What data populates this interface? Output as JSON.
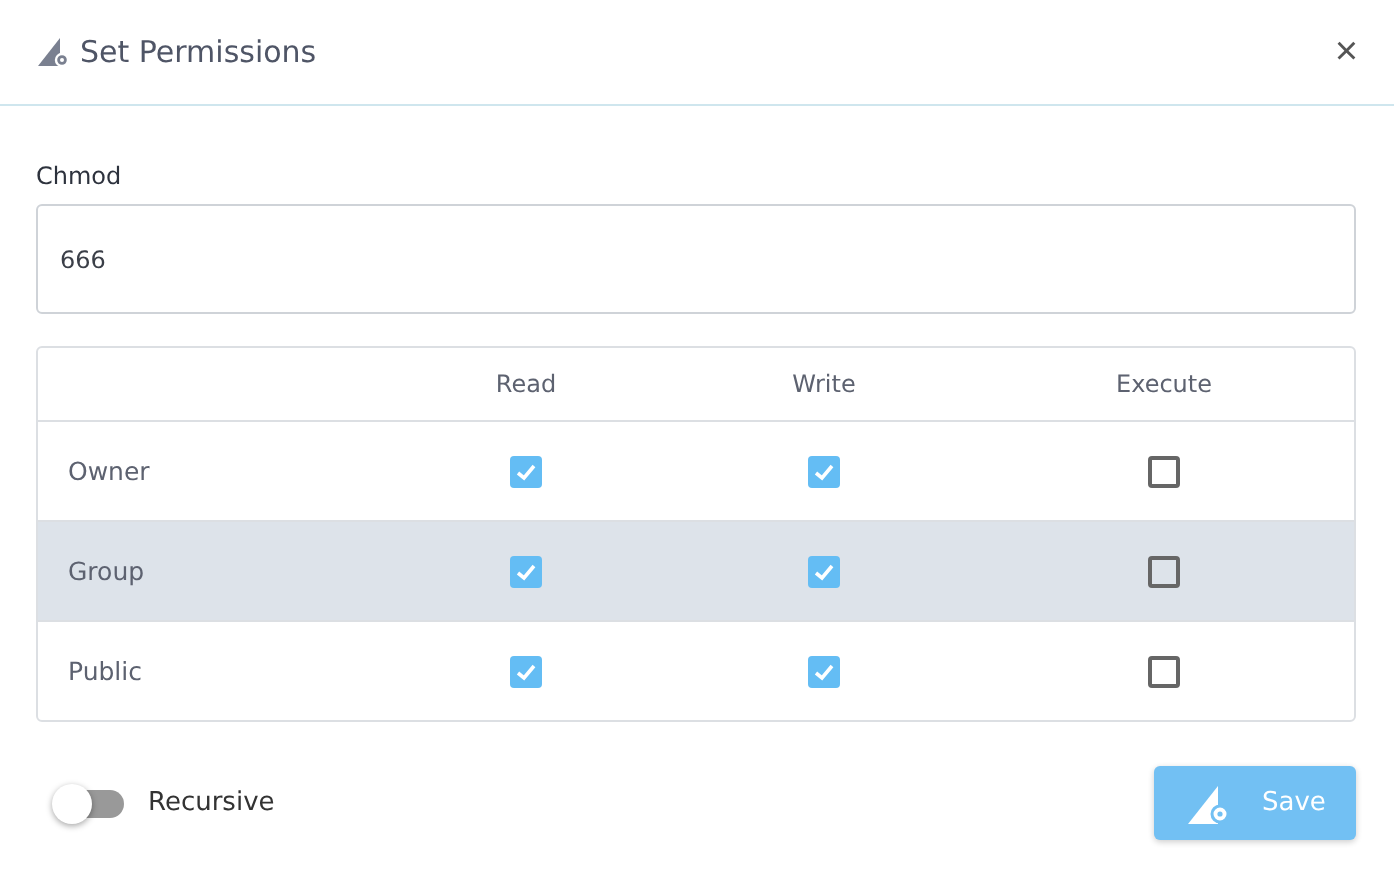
{
  "dialog": {
    "title": "Set Permissions",
    "close": "×"
  },
  "chmod": {
    "label": "Chmod",
    "value": "666"
  },
  "permissions": {
    "columns": [
      "Read",
      "Write",
      "Execute"
    ],
    "rows": [
      {
        "name": "Owner",
        "selected": false,
        "read": true,
        "write": true,
        "execute": false
      },
      {
        "name": "Group",
        "selected": true,
        "read": true,
        "write": true,
        "execute": false
      },
      {
        "name": "Public",
        "selected": false,
        "read": true,
        "write": true,
        "execute": false
      }
    ]
  },
  "recursive": {
    "label": "Recursive",
    "on": false
  },
  "save_button": {
    "label": "Save"
  }
}
